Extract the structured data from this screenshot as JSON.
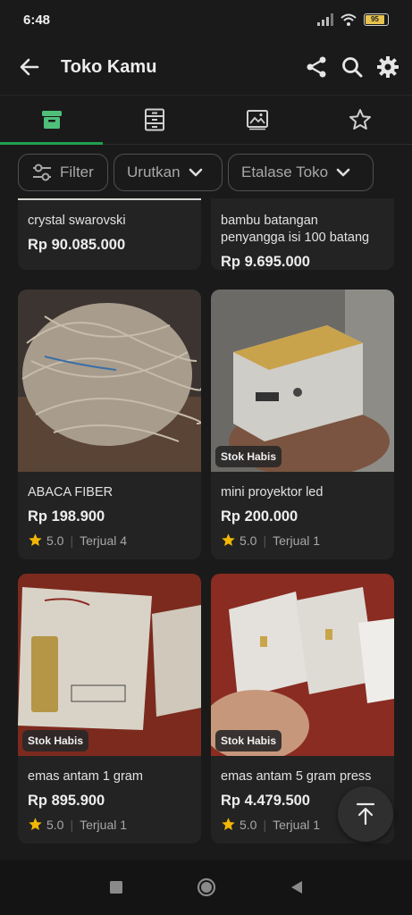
{
  "status": {
    "time": "6:48",
    "battery": "95"
  },
  "app_bar": {
    "title": "Toko Kamu"
  },
  "filters": {
    "filter_label": "Filter",
    "sort_label": "Urutkan",
    "showcase_label": "Etalase Toko"
  },
  "products": [
    {
      "name": "crystal swarovski",
      "price": "Rp 90.085.000"
    },
    {
      "name": "bambu batangan penyangga isi 100 batang",
      "price": "Rp 9.695.000"
    },
    {
      "name": "ABACA FIBER",
      "price": "Rp 198.900",
      "rating": "5.0",
      "sold": "Terjual 4"
    },
    {
      "name": "mini proyektor led",
      "price": "Rp 200.000",
      "rating": "5.0",
      "sold": "Terjual 1",
      "badge": "Stok Habis"
    },
    {
      "name": "emas antam 1 gram",
      "price": "Rp 895.900",
      "rating": "5.0",
      "sold": "Terjual 1",
      "badge": "Stok Habis"
    },
    {
      "name": "emas antam 5 gram press",
      "price": "Rp 4.479.500",
      "rating": "5.0",
      "sold": "Terjual 1",
      "badge": "Stok Habis"
    }
  ],
  "colors": {
    "accent": "#1fa14f",
    "star": "#f2b705",
    "background": "#1a1a1a"
  }
}
